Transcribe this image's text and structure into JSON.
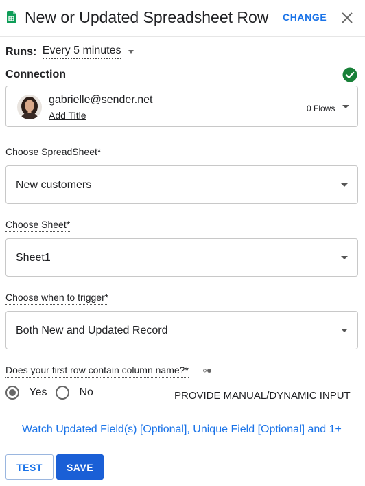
{
  "header": {
    "title": "New or Updated Spreadsheet Row",
    "change_label": "CHANGE"
  },
  "runs": {
    "label": "Runs:",
    "value": "Every 5 minutes"
  },
  "connection": {
    "label": "Connection",
    "email": "gabrielle@sender.net",
    "add_title": "Add Title",
    "flows": "0 Flows"
  },
  "fields": [
    {
      "label": "Choose SpreadSheet*",
      "value": "New customers"
    },
    {
      "label": "Choose Sheet*",
      "value": "Sheet1"
    },
    {
      "label": "Choose when to trigger*",
      "value": "Both New and Updated Record"
    }
  ],
  "column_question": {
    "label": "Does your first row contain column name?*",
    "yes_label": "Yes",
    "no_label": "No",
    "selected": "Yes"
  },
  "manual_input_label": "PROVIDE MANUAL/DYNAMIC INPUT",
  "watch_link": "Watch Updated Field(s) [Optional], Unique Field [Optional] and 1+",
  "buttons": {
    "test_label": "TEST",
    "save_label": "SAVE"
  },
  "colors": {
    "accent": "#1a73e8",
    "save_bg": "#1a5fd6",
    "success": "#188038",
    "sheets_green": "#0f9d58"
  },
  "icons": {
    "app": "google-sheets-icon",
    "close": "close-icon",
    "connected": "check-circle-icon",
    "info": "info-dots-icon"
  }
}
